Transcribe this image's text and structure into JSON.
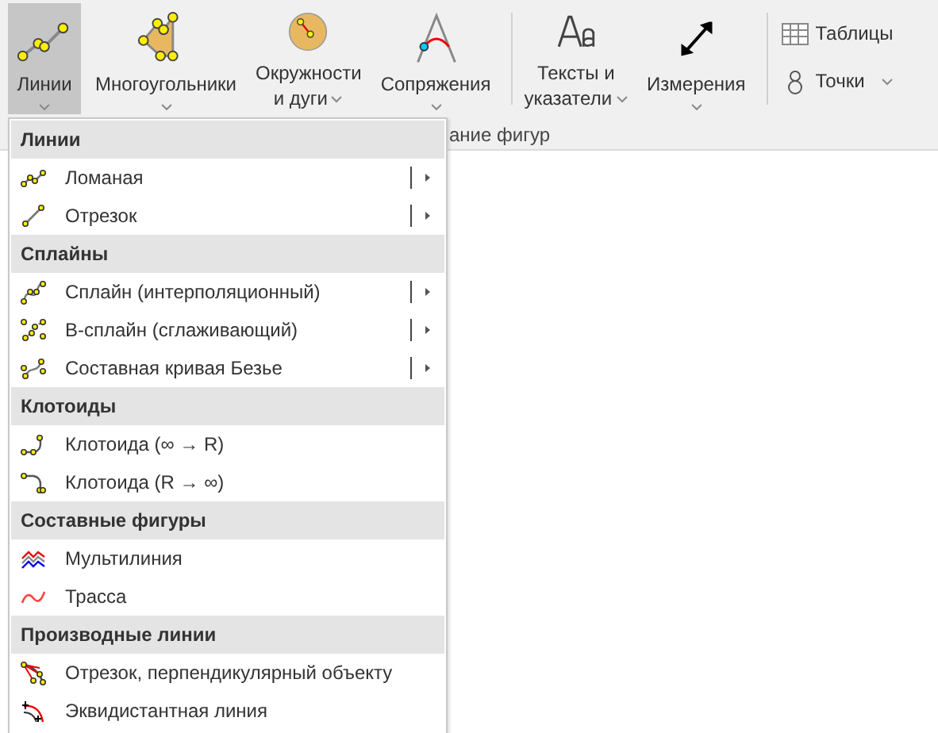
{
  "ribbon": {
    "buttons": [
      {
        "lines": [
          "Линии"
        ],
        "selected": true,
        "dropdown": true
      },
      {
        "lines": [
          "Многоугольники"
        ],
        "selected": false,
        "dropdown": true
      },
      {
        "lines": [
          "Окружности",
          "и дуги"
        ],
        "selected": false,
        "dropdown": true
      },
      {
        "lines": [
          "Сопряжения"
        ],
        "selected": false,
        "dropdown": true
      },
      {
        "lines": [
          "Тексты и",
          "указатели"
        ],
        "selected": false,
        "dropdown": true
      },
      {
        "lines": [
          "Измерения"
        ],
        "selected": false,
        "dropdown": true
      }
    ],
    "small_buttons": [
      {
        "label": "Таблицы",
        "dropdown": false
      },
      {
        "label": "Точки",
        "dropdown": true
      }
    ],
    "group_label": "ание фигур"
  },
  "menu": {
    "sections": [
      {
        "title": "Линии",
        "items": [
          {
            "label": "Ломаная",
            "submenu": true
          },
          {
            "label": "Отрезок",
            "submenu": true
          }
        ]
      },
      {
        "title": "Сплайны",
        "items": [
          {
            "label": "Сплайн (интерполяционный)",
            "submenu": true
          },
          {
            "label": "B-сплайн (сглаживающий)",
            "submenu": true
          },
          {
            "label": "Составная кривая Безье",
            "submenu": true
          }
        ]
      },
      {
        "title": "Клотоиды",
        "items": [
          {
            "label": "Клотоида (∞ → R)",
            "submenu": false
          },
          {
            "label": "Клотоида (R → ∞)",
            "submenu": false
          }
        ]
      },
      {
        "title": "Составные фигуры",
        "items": [
          {
            "label": "Мультилиния",
            "submenu": false
          },
          {
            "label": "Трасса",
            "submenu": false
          }
        ]
      },
      {
        "title": "Производные линии",
        "items": [
          {
            "label": "Отрезок, перпендикулярный объекту",
            "submenu": false
          },
          {
            "label": "Эквидистантная линия",
            "submenu": false
          }
        ]
      }
    ]
  }
}
